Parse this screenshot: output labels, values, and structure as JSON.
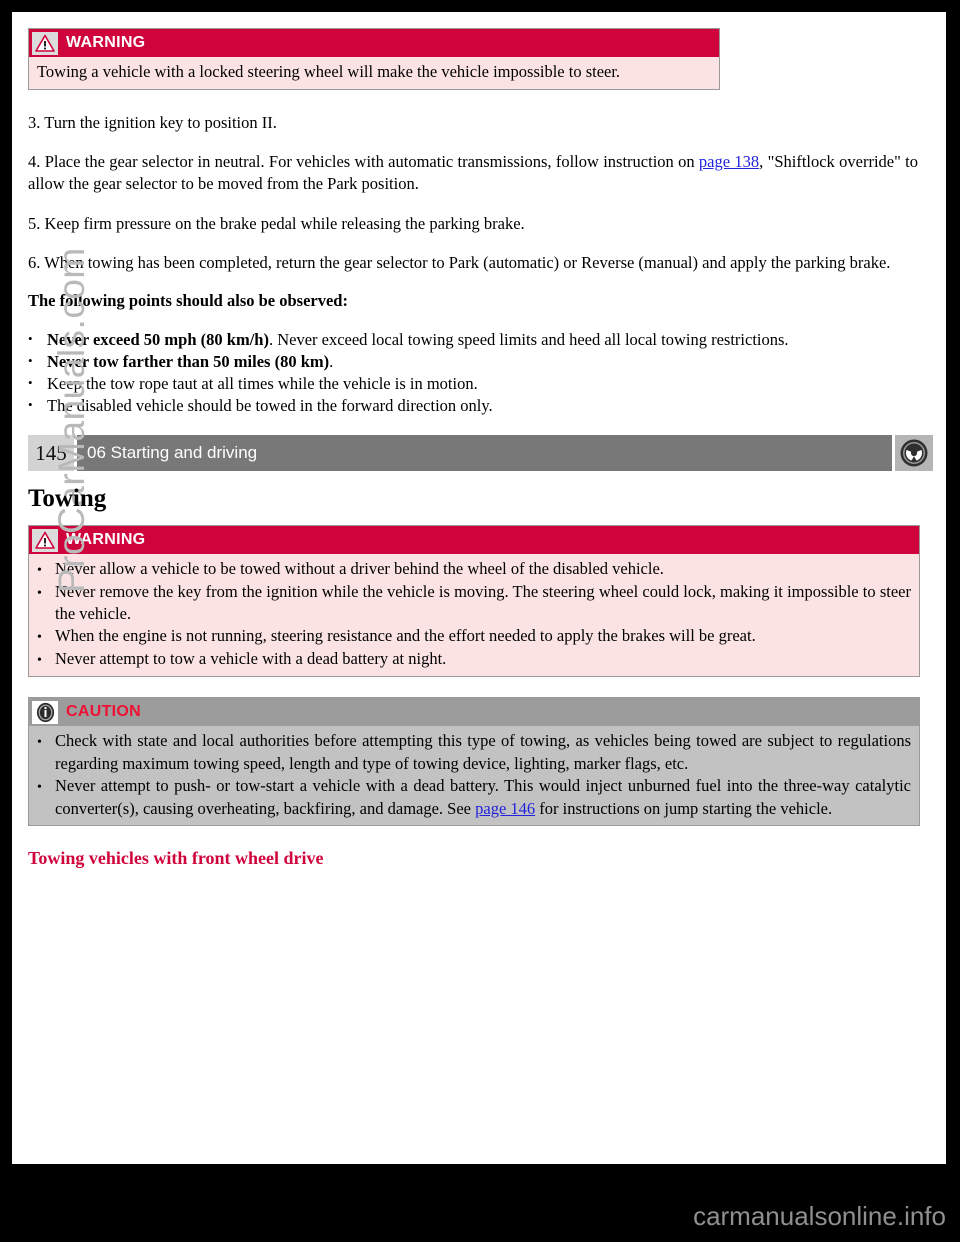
{
  "document": {
    "page_number": "145",
    "chapter": "06 Starting and driving",
    "logo_icon": "volvo-steering-wheel-icon",
    "watermark": "ProCarManuals.com",
    "footer_brand": "carmanualsonline.info"
  },
  "colors": {
    "warning_header": "#D0043C",
    "warning_body": "#FBE3E4",
    "caution_header": "#9C9C9C",
    "caution_body": "#C2C2C2",
    "chapter_bar": "#787878",
    "page_num_box": "#D3D3D3",
    "link": "#2222DD",
    "subsection_red": "#D0043C",
    "watermark_gray": "#B9B9B9",
    "footer_gray": "#8F8F8F"
  },
  "alerts": {
    "warning_label": "WARNING",
    "caution_label": "CAUTION",
    "warning_icon": "warning-triangle-icon",
    "caution_icon": "info-circle-icon"
  },
  "top_warning": {
    "text": "Towing a vehicle with a locked steering wheel will make the vehicle impossible to steer."
  },
  "steps": [
    {
      "id": "step-3",
      "text": "3. Turn the ignition key to position II."
    },
    {
      "id": "step-4",
      "prefix": "4. Place the gear selector in neutral. For vehicles with automatic transmissions, follow instruction on ",
      "link": "page 138",
      "suffix": ", \"Shiftlock override\" to allow the gear selector to be moved from the Park position."
    },
    {
      "id": "step-5",
      "text": "5. Keep firm pressure on the brake pedal while releasing the parking brake."
    },
    {
      "id": "step-6",
      "text": "6. When towing has been completed, return the gear selector to Park (automatic) or Reverse (manual) and apply the parking brake."
    }
  ],
  "observed_heading": "The following points should also be observed:",
  "observed_points": [
    {
      "bold": "Never exceed 50 mph (80 km/h)",
      "rest": ". Never exceed local towing speed limits and heed all local towing restrictions."
    },
    {
      "bold": "Never tow farther than 50 miles (80 km)",
      "rest": "."
    },
    {
      "bold": "",
      "rest": "Keep the tow rope taut at all times while the vehicle is in motion."
    },
    {
      "bold": "",
      "rest": "The disabled vehicle should be towed in the forward direction only."
    }
  ],
  "towing_section": {
    "title": "Towing",
    "warning_points": [
      "Never allow a vehicle to be towed without a driver behind the wheel of the disabled vehicle.",
      "Never remove the key from the ignition while the vehicle is moving. The steering wheel could lock, making it impossible to steer the vehicle.",
      "When the engine is not running, steering resistance and the effort needed to apply the brakes will be great.",
      "Never attempt to tow a vehicle with a dead battery at night."
    ],
    "caution_point_1": "Check with state and local authorities before attempting this type of towing, as vehicles being towed are subject to regulations regarding maximum towing speed, length and type of towing device, lighting, marker flags, etc.",
    "caution_point_2_prefix": "Never attempt to push- or tow-start a vehicle with a dead battery. This would inject unburned fuel into the three-way catalytic converter(s), causing overheating, backfiring, and damage. See ",
    "caution_point_2_link": "page 146",
    "caution_point_2_suffix": " for instructions on jump starting the vehicle.",
    "subsection_title": "Towing vehicles with front wheel drive"
  }
}
